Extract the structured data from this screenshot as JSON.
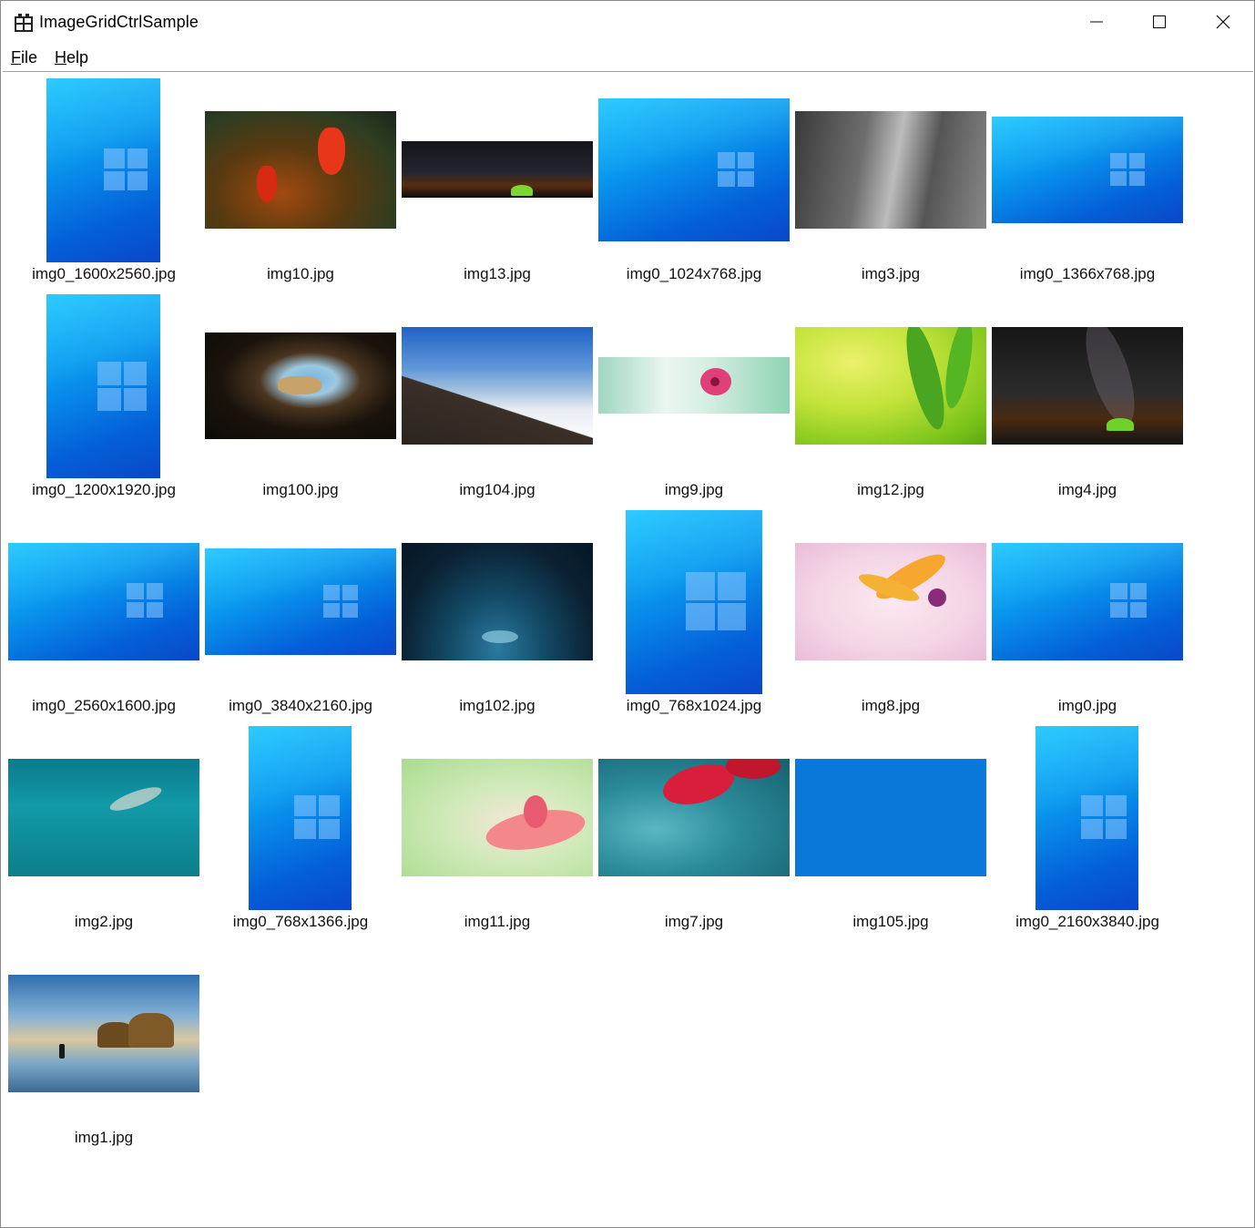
{
  "window": {
    "title": "ImageGridCtrlSample"
  },
  "menu": {
    "file_label": "File",
    "file_accel": "F",
    "file_rest": "ile",
    "help_label": "Help",
    "help_accel": "H",
    "help_rest": "elp"
  },
  "grid": {
    "items": [
      {
        "name": "img0_1600x2560.jpg"
      },
      {
        "name": "img10.jpg"
      },
      {
        "name": "img13.jpg"
      },
      {
        "name": "img0_1024x768.jpg"
      },
      {
        "name": "img3.jpg"
      },
      {
        "name": "img0_1366x768.jpg"
      },
      {
        "name": "img0_1200x1920.jpg"
      },
      {
        "name": "img100.jpg"
      },
      {
        "name": "img104.jpg"
      },
      {
        "name": "img9.jpg"
      },
      {
        "name": "img12.jpg"
      },
      {
        "name": "img4.jpg"
      },
      {
        "name": "img0_2560x1600.jpg"
      },
      {
        "name": "img0_3840x2160.jpg"
      },
      {
        "name": "img102.jpg"
      },
      {
        "name": "img0_768x1024.jpg"
      },
      {
        "name": "img8.jpg"
      },
      {
        "name": "img0.jpg"
      },
      {
        "name": "img2.jpg"
      },
      {
        "name": "img0_768x1366.jpg"
      },
      {
        "name": "img11.jpg"
      },
      {
        "name": "img7.jpg"
      },
      {
        "name": "img105.jpg"
      },
      {
        "name": "img0_2160x3840.jpg"
      },
      {
        "name": "img1.jpg"
      }
    ]
  }
}
